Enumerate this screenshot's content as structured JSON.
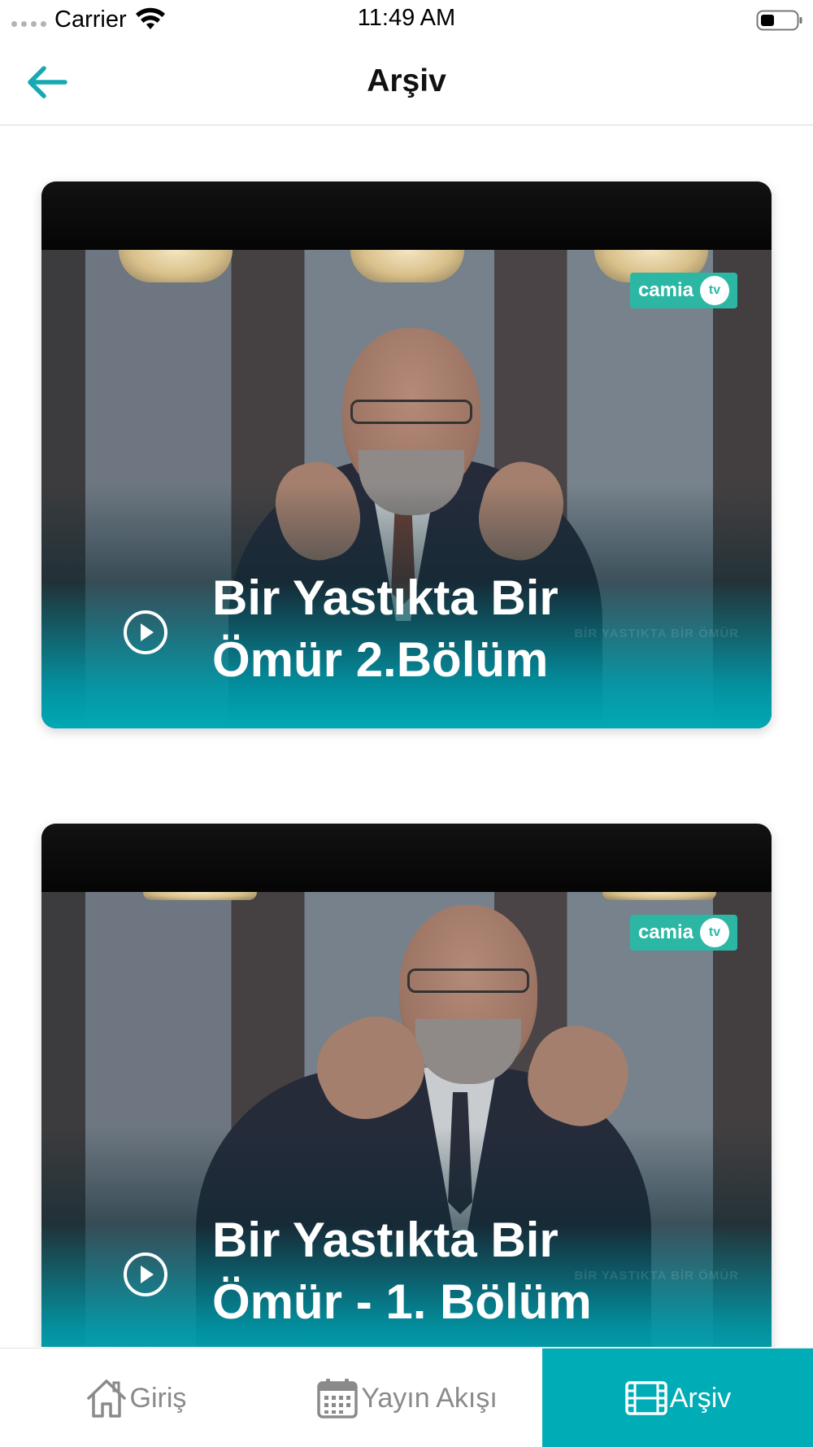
{
  "status_bar": {
    "carrier": "Carrier",
    "time": "11:49 AM"
  },
  "nav": {
    "title": "Arşiv",
    "back_icon": "arrow-left-icon",
    "accent_color": "#16a9b5"
  },
  "videos": [
    {
      "title_line1": "Bir Yastıkta Bir",
      "title_line2": "Ömür 2.Bölüm",
      "logo_text": "camia",
      "logo_badge": "tv",
      "watermark": "BİR YASTIKTA BİR ÖMÜR"
    },
    {
      "title_line1": "Bir Yastıkta Bir",
      "title_line2": "Ömür - 1. Bölüm",
      "logo_text": "camia",
      "logo_badge": "tv",
      "watermark": "BİR YASTIKTA BİR ÖMÜR"
    }
  ],
  "tabs": [
    {
      "label": "Giriş",
      "icon": "home-icon",
      "active": false
    },
    {
      "label": "Yayın Akışı",
      "icon": "calendar-icon",
      "active": false
    },
    {
      "label": "Arşiv",
      "icon": "film-icon",
      "active": true
    }
  ],
  "colors": {
    "active_tab_bg": "#00acb6",
    "inactive_tab_text": "#8a8a8a",
    "overlay_teal": "#00a9b5",
    "logo_green": "#2cb7a5"
  }
}
